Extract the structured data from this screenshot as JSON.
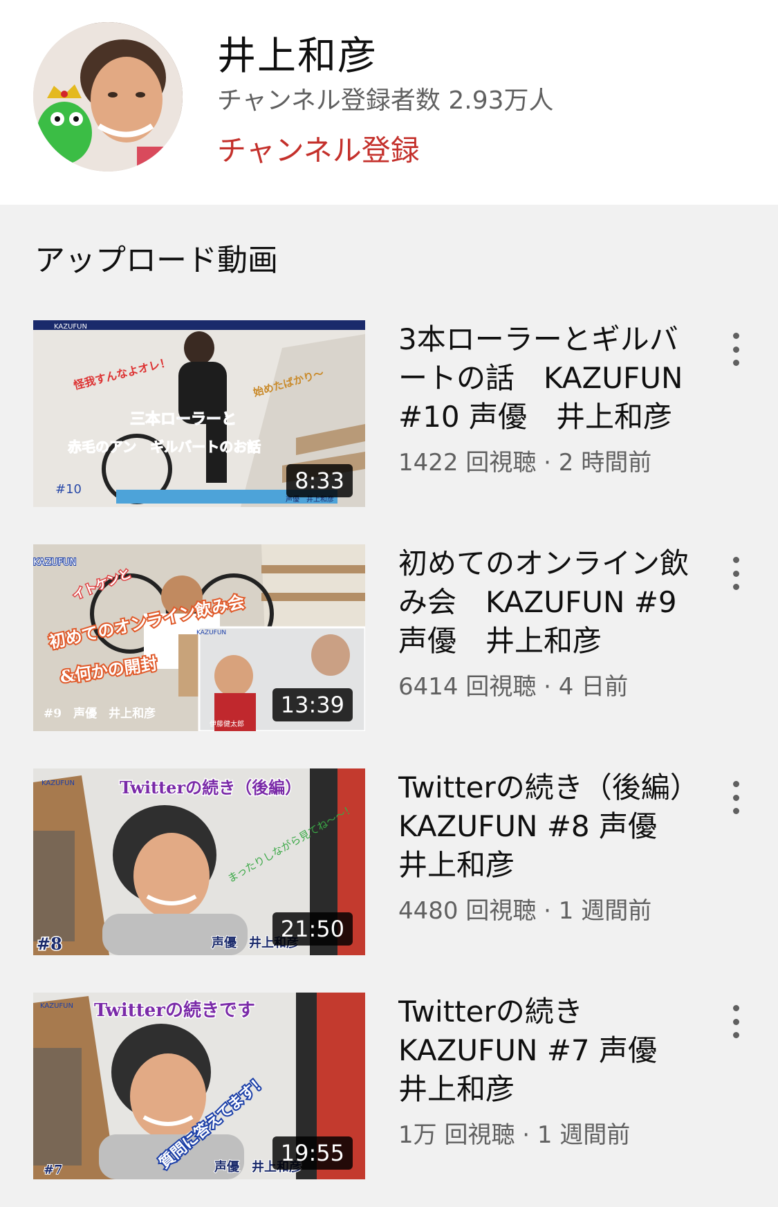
{
  "channel": {
    "name": "井上和彦",
    "subscribers": "チャンネル登録者数 2.93万人",
    "subscribe_label": "チャンネル登録"
  },
  "section": {
    "title": "アップロード動画"
  },
  "videos": [
    {
      "title": "3本ローラーとギルバートの話　KAZUFUN #10 声優　井上和彦",
      "meta": "1422 回視聴 · 2 時間前",
      "duration": "8:33",
      "thumb_text": [
        "KAZUFUN",
        "怪我すんなよオレ！",
        "始めたばかり〜",
        "三本ローラーと",
        "赤毛のアン　ギルバートのお話",
        "#10",
        "声優　井上和彦"
      ]
    },
    {
      "title": "初めてのオンライン飲み会　KAZUFUN #9 声優　井上和彦",
      "meta": "6414 回視聴 · 4 日前",
      "duration": "13:39",
      "thumb_text": [
        "KAZUFUN",
        "イトケンと",
        "初めてのオンライン飲み会",
        "&何かの開封",
        "#9　声優　井上和彦",
        "KAZUFUN",
        "伊藤健太郎"
      ]
    },
    {
      "title": "Twitterの続き（後編）KAZUFUN #8 声優　井上和彦",
      "meta": "4480 回視聴 · 1 週間前",
      "duration": "21:50",
      "thumb_text": [
        "KAZUFUN",
        "Twitterの続き（後編）",
        "まったりしながら見てね〜〜！",
        "#8",
        "声優　井上和彦"
      ]
    },
    {
      "title": "Twitterの続き　KAZUFUN #7 声優　井上和彦",
      "meta": "1万 回視聴 · 1 週間前",
      "duration": "19:55",
      "thumb_text": [
        "KAZUFUN",
        "Twitterの続きです",
        "質問に答えてます！",
        "#7",
        "声優　井上和彦"
      ]
    }
  ]
}
